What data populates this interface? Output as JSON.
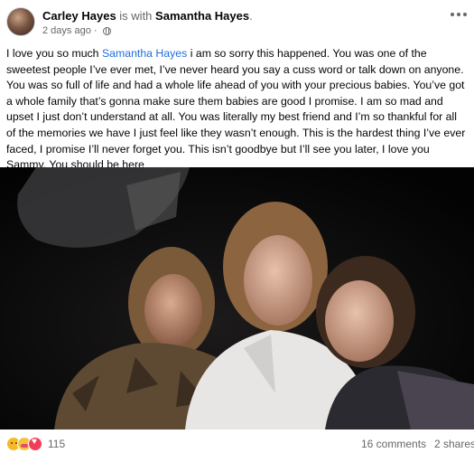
{
  "post": {
    "author": "Carley Hayes",
    "with_word": "is with",
    "tagged_name": "Samantha Hayes",
    "period": ".",
    "timestamp": "2 days ago",
    "separator": "·",
    "text_before_tag": "I love you so much ",
    "text_tag": "Samantha Hayes",
    "text_after_tag": " i am so sorry this happened. You was one of the sweetest people I’ve ever met, I’ve never heard you say a cuss word or talk down on anyone. You was so full of life and had a whole life ahead of you with your precious babies. You’ve got a whole family that’s gonna make sure them babies are good I promise. I am so mad and upset I just don’t understand at all. You was literally my best friend and I’m so thankful for all of the memories we have I just feel like they wasn’t enough. This is the hardest thing I’ve ever faced, I promise I’ll never forget you. This isn’t goodbye but I’ll see you later, I love you Sammy. You should be here",
    "text_emoji": "💔"
  },
  "footer": {
    "reaction_icons": [
      "sad-icon",
      "care-icon",
      "love-icon"
    ],
    "reaction_count": "115",
    "comments": "16 comments",
    "shares": "2 shares"
  },
  "colors": {
    "link": "#216fdb",
    "muted": "#65676b",
    "text": "#050505"
  }
}
